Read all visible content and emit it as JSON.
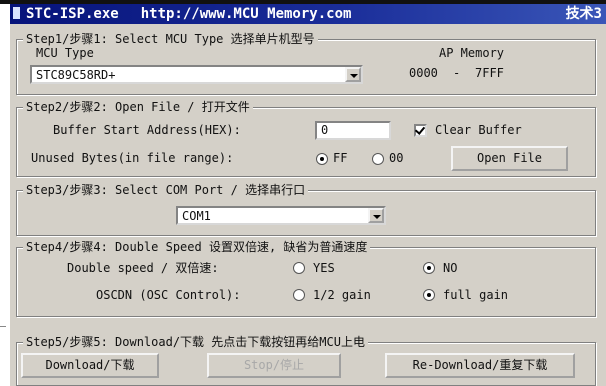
{
  "titlebar": {
    "app_name": "STC-ISP.exe",
    "url": "http://www.MCU Memory.com",
    "tail_text": "技术3"
  },
  "step1": {
    "legend": "Step1/步骤1: Select MCU Type  选择单片机型号",
    "mcu_type_label": "MCU Type",
    "mcu_type_value": "STC89C58RD+",
    "ap_memory_label": "AP Memory",
    "ap_start": "0000",
    "ap_sep": "-",
    "ap_end": "7FFF"
  },
  "step2": {
    "legend": "Step2/步骤2: Open File / 打开文件",
    "buffer_addr_label": "Buffer Start Address(HEX):",
    "buffer_addr_value": "0",
    "clear_buffer_label": "Clear Buffer",
    "clear_buffer_checked": true,
    "unused_bytes_label": "Unused Bytes(in file range):",
    "opt_ff": "FF",
    "opt_00": "00",
    "selected": "FF",
    "open_file_button": "Open File"
  },
  "step3": {
    "legend": "Step3/步骤3: Select COM Port / 选择串行口",
    "com_value": "COM1"
  },
  "step4": {
    "legend": "Step4/步骤4: Double Speed  设置双倍速, 缺省为普通速度",
    "double_speed_label": "Double speed / 双倍速:",
    "opt_yes": "YES",
    "opt_no": "NO",
    "double_speed_selected": "NO",
    "oscdn_label": "OSCDN (OSC Control):",
    "opt_half": "1/2 gain",
    "opt_full": "full gain",
    "oscdn_selected": "full gain"
  },
  "step5": {
    "legend": "Step5/步骤5: Download/下载   先点击下载按钮再给MCU上电",
    "download_button": "Download/下载",
    "stop_button": "Stop/停止",
    "redownload_button": "Re-Download/重复下载"
  }
}
